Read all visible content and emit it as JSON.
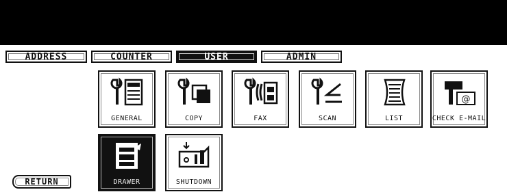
{
  "tabs": [
    {
      "label": "ADDRESS",
      "active": false
    },
    {
      "label": "COUNTER",
      "active": false
    },
    {
      "label": "USER",
      "active": true
    },
    {
      "label": "ADMIN",
      "active": false
    }
  ],
  "functions": [
    {
      "label": "GENERAL",
      "icon": "wrench-copier-icon"
    },
    {
      "label": "COPY",
      "icon": "wrench-copy-icon"
    },
    {
      "label": "FAX",
      "icon": "wrench-fax-icon"
    },
    {
      "label": "SCAN",
      "icon": "wrench-scan-icon"
    },
    {
      "label": "LIST",
      "icon": "list-document-icon"
    },
    {
      "label": "CHECK E-MAIL",
      "icon": "email-check-icon"
    },
    {
      "label": "DRAWER",
      "icon": "drawer-icon",
      "dark": true
    },
    {
      "label": "SHUTDOWN",
      "icon": "power-switch-icon"
    }
  ],
  "return_label": "RETURN",
  "colors": {
    "background": "#000000",
    "panel": "#ffffff",
    "active_tab": "#111111"
  }
}
